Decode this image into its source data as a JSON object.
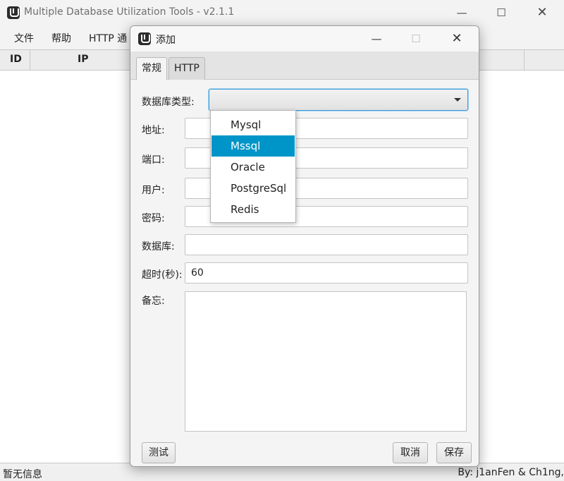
{
  "window": {
    "title": "Multiple Database Utilization Tools - v2.1.1",
    "minimize_icon": "minimize-icon",
    "maximize_icon": "maximize-icon",
    "close_icon": "close-icon"
  },
  "menu": [
    "文件",
    "帮助",
    "HTTP 通"
  ],
  "table": {
    "columns": [
      "ID",
      "IP"
    ]
  },
  "status": {
    "left": "暂无信息",
    "right": "By: j1anFen & Ch1ng,"
  },
  "dialog": {
    "title": "添加",
    "tabs": [
      "常规",
      "HTTP"
    ],
    "labels": {
      "db_type": "数据库类型:",
      "host": "地址:",
      "port": "端口:",
      "user": "用户:",
      "password": "密码:",
      "database": "数据库:",
      "timeout": "超时(秒):",
      "memo": "备忘:"
    },
    "values": {
      "host": "",
      "port": "",
      "user": "",
      "password": "",
      "database": "",
      "timeout": "60",
      "memo": ""
    },
    "db_type_options": [
      "Mysql",
      "Mssql",
      "Oracle",
      "PostgreSql",
      "Redis"
    ],
    "db_type_highlighted": "Mssql",
    "buttons": {
      "test": "测试",
      "cancel": "取消",
      "save": "保存"
    }
  },
  "colors": {
    "accent": "#0095c8",
    "focus": "#3a9ad9"
  }
}
